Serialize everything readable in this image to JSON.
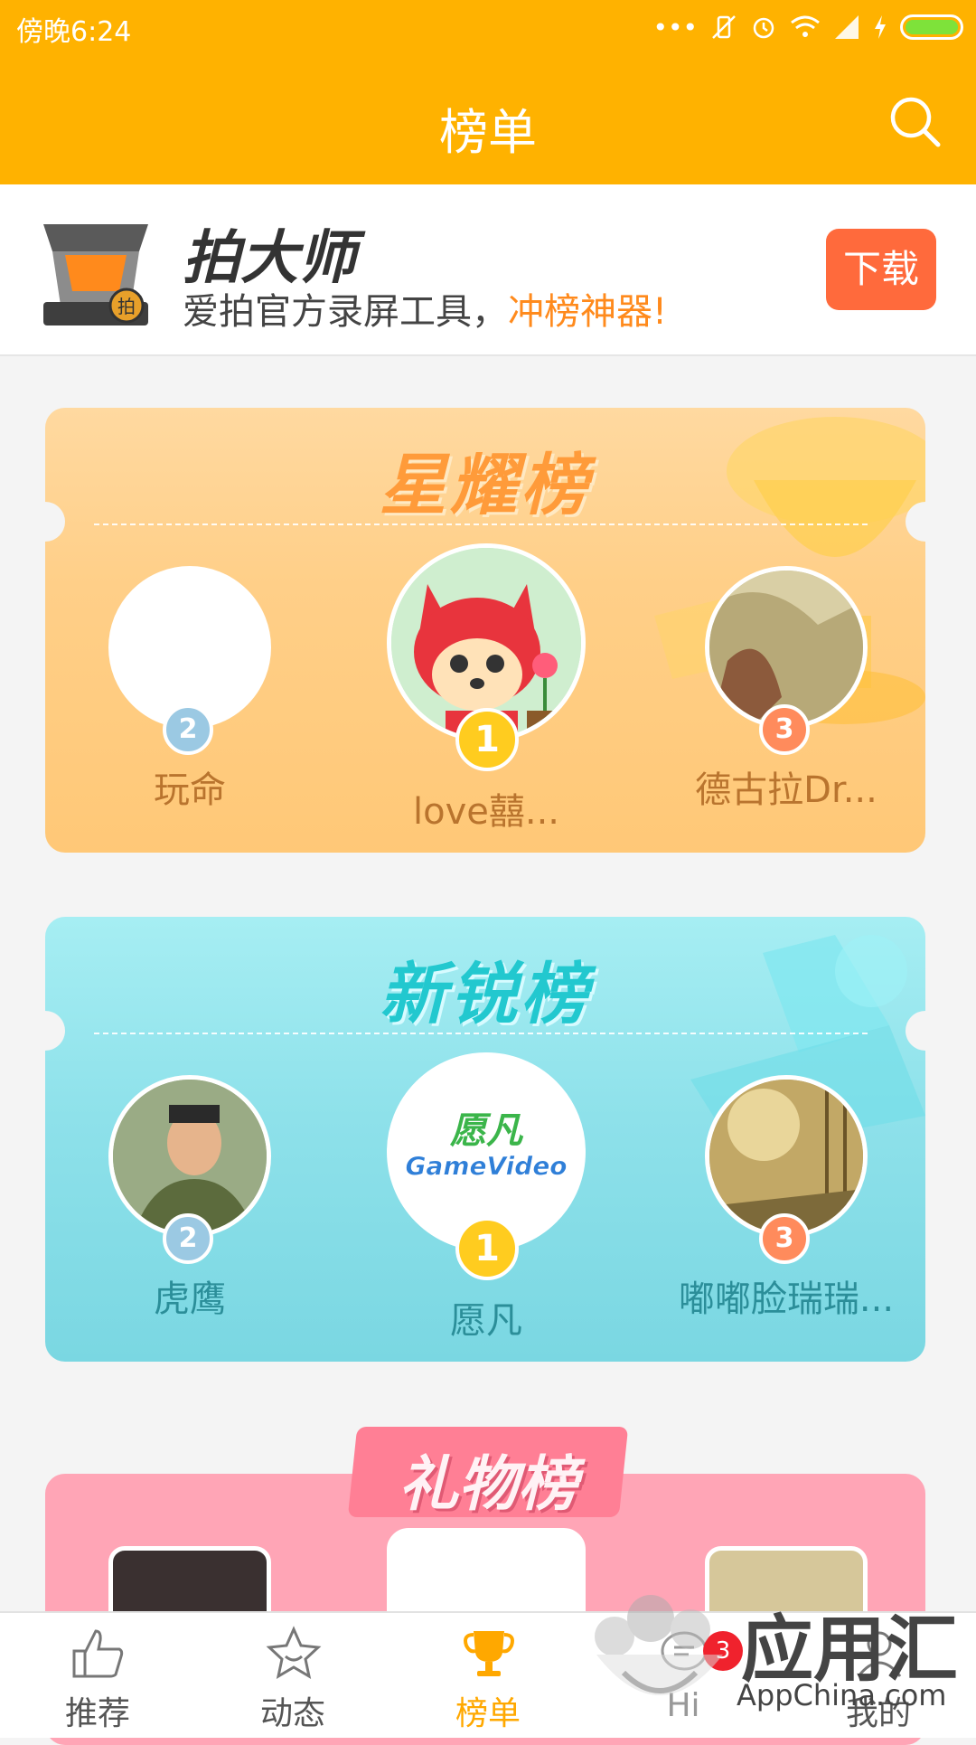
{
  "status_bar": {
    "time": "傍晚6:24",
    "icons": [
      "more-dots-icon",
      "vibrate-off-icon",
      "alarm-icon",
      "wifi-icon",
      "signal-icon",
      "charging-icon",
      "battery-icon"
    ]
  },
  "header": {
    "title": "榜单",
    "search_icon": "search-icon"
  },
  "ad": {
    "brand": "拍大师",
    "slogan": "爱拍官方录屏工具，",
    "slogan_highlight": "冲榜神器!",
    "download_label": "下载",
    "accent_color": "#ff6a3c",
    "logo_badge": "拍"
  },
  "boards": [
    {
      "title": "星耀榜",
      "theme_color": "#ffb04a",
      "users": [
        {
          "rank": "2",
          "name": "玩命"
        },
        {
          "rank": "1",
          "name": "love囍..."
        },
        {
          "rank": "3",
          "name": "德古拉Dr..."
        }
      ]
    },
    {
      "title": "新锐榜",
      "theme_color": "#4fd3dd",
      "users": [
        {
          "rank": "2",
          "name": "虎鹰"
        },
        {
          "rank": "1",
          "name": "愿凡"
        },
        {
          "rank": "3",
          "name": "嘟嘟脸瑞瑞..."
        }
      ],
      "logo_text_top": "愿凡",
      "logo_text_bottom": "GameVideo"
    },
    {
      "title": "礼物榜",
      "theme_color": "#ff8fa3"
    }
  ],
  "bottom_nav": [
    {
      "label": "推荐",
      "icon": "thumbs-up-icon"
    },
    {
      "label": "动态",
      "icon": "star-icon"
    },
    {
      "label": "榜单",
      "icon": "trophy-icon",
      "active": true
    },
    {
      "label": "Hi",
      "icon": "chat-icon",
      "badge": "3"
    },
    {
      "label": "我的",
      "icon": "profile-icon"
    }
  ],
  "watermark": {
    "text": "应用汇",
    "sub": "AppChina.com"
  },
  "colors": {
    "primary": "#ffb200",
    "active_tab": "#ffa800",
    "badge": "#f0222d"
  }
}
